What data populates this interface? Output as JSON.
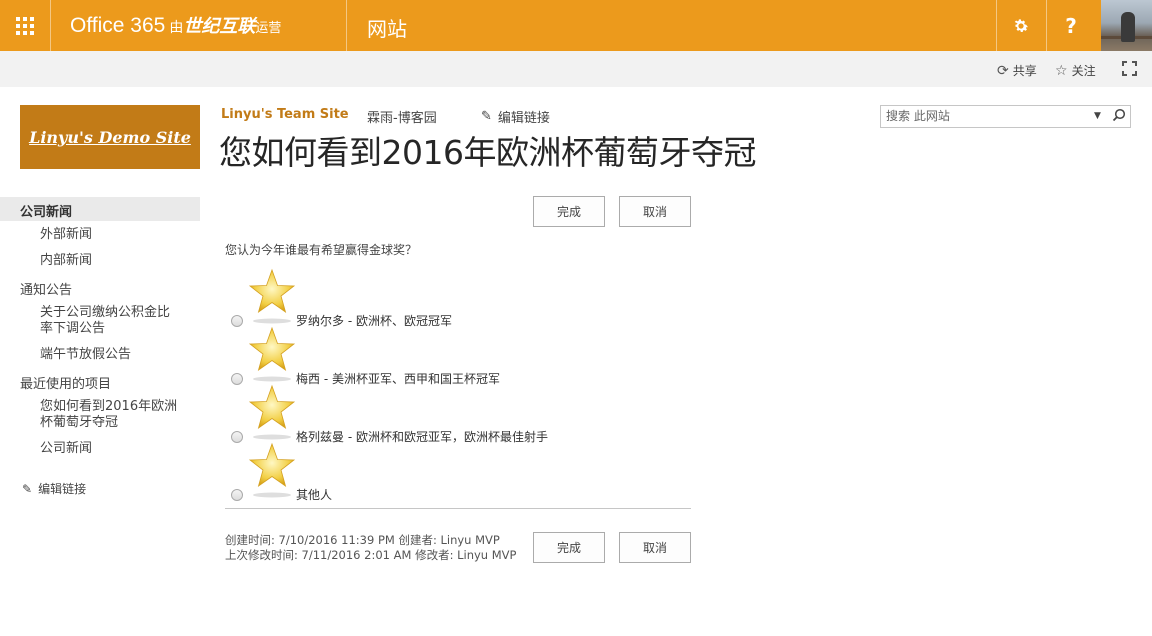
{
  "suite": {
    "product": "Office 365",
    "by": "由",
    "partner": "世纪互联",
    "operated": "运营",
    "app_name": "网站",
    "settings_icon": "gear-icon",
    "help_label": "?"
  },
  "ribbon": {
    "share_label": "共享",
    "follow_label": "关注"
  },
  "site": {
    "logo_text": "Linyu's Demo Site",
    "team_site": "Linyu's Team Site",
    "blog_link": "霖雨-博客园",
    "edit_links": "编辑链接",
    "page_title": "您如何看到2016年欧洲杯葡萄牙夺冠"
  },
  "search": {
    "placeholder": "搜索 此网站"
  },
  "quick_launch": {
    "items": [
      {
        "label": "公司新闻"
      },
      {
        "label": "外部新闻"
      },
      {
        "label": "内部新闻"
      },
      {
        "label": "通知公告"
      },
      {
        "label": "关于公司缴纳公积金比"
      },
      {
        "label": "率下调公告"
      },
      {
        "label": "端午节放假公告"
      },
      {
        "label": "最近使用的项目"
      },
      {
        "label": "您如何看到2016年欧洲"
      },
      {
        "label": "杯葡萄牙夺冠"
      },
      {
        "label": "公司新闻"
      }
    ],
    "edit_links": "编辑链接"
  },
  "survey": {
    "finish_label": "完成",
    "cancel_label": "取消",
    "question": "您认为今年谁最有希望赢得金球奖？",
    "options": [
      {
        "label": "罗纳尔多 - 欧洲杯、欧冠冠军"
      },
      {
        "label": "梅西 - 美洲杯亚军、西甲和国王杯冠军"
      },
      {
        "label": "格列兹曼 - 欧洲杯和欧冠亚军，欧洲杯最佳射手"
      },
      {
        "label": "其他人"
      }
    ],
    "created_line": "创建时间: 7/10/2016 11:39 PM 创建者: Linyu MVP",
    "modified_line": "上次修改时间: 7/11/2016 2:01 AM 修改者: Linyu MVP"
  },
  "colors": {
    "suite_bar": "#ec9a1c",
    "logo_bg": "#c27b17",
    "accent_text": "#c27b17"
  }
}
